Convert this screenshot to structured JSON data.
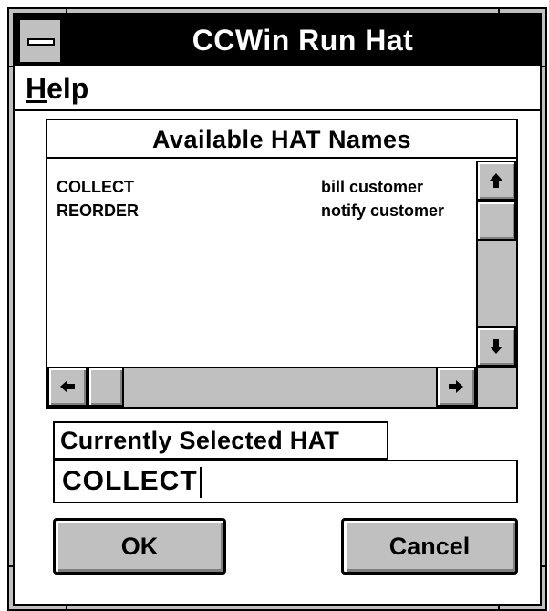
{
  "window": {
    "title": "CCWin Run Hat"
  },
  "menubar": {
    "help_mnemonic": "H",
    "help_rest": "elp"
  },
  "hat_list": {
    "header": "Available HAT Names",
    "items": [
      {
        "name": "COLLECT",
        "description": "bill customer"
      },
      {
        "name": "REORDER",
        "description": "notify customer"
      }
    ]
  },
  "selected": {
    "label": "Currently Selected HAT",
    "value": "COLLECT"
  },
  "buttons": {
    "ok": "OK",
    "cancel": "Cancel"
  },
  "colors": {
    "face": "#c0c0c0",
    "titlebar": "#000000",
    "window": "#ffffff"
  },
  "icons": {
    "sysmenu": "system-menu-icon",
    "up": "arrow-up-icon",
    "down": "arrow-down-icon",
    "left": "arrow-left-icon",
    "right": "arrow-right-icon"
  }
}
